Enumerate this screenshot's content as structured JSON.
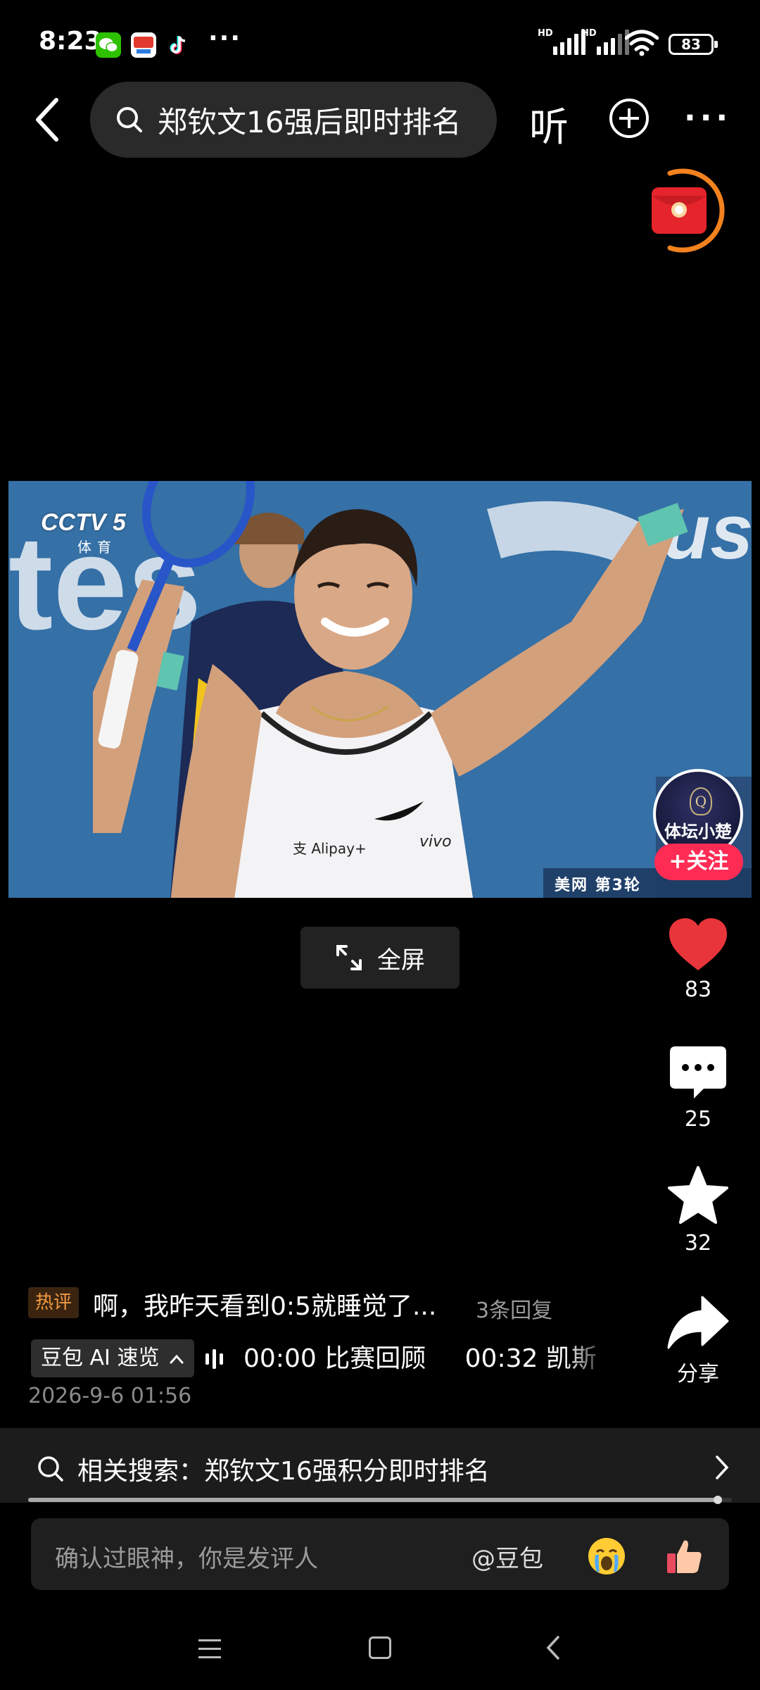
{
  "status_bar": {
    "time": "8:23",
    "more": "···",
    "battery": "83",
    "hd1": "HD",
    "hd2": "HD"
  },
  "header": {
    "search_query": "郑钦文16强后即时排名",
    "listen_label": "听"
  },
  "video": {
    "channel_logo": "CCTV 5",
    "channel_sub": "体育",
    "caption": "美网 第3轮",
    "shirt_sponsor_1": "支 Alipay+",
    "shirt_sponsor_2": "vivo"
  },
  "fullscreen_label": "全屏",
  "author": {
    "name": "体坛小楚",
    "badge": "Q",
    "follow_label": "+关注"
  },
  "rail": {
    "likes": "83",
    "comments": "25",
    "favorites": "32",
    "share_label": "分享"
  },
  "hot_comment": {
    "tag": "热评",
    "text": "啊，我昨天看到0:5就睡觉了...",
    "replies": "3条回复"
  },
  "ai_summary": {
    "chip_label": "豆包 AI 速览",
    "chapters": [
      "00:00 比赛回顾",
      "00:32 凯斯"
    ]
  },
  "post_date": "2026-9-6 01:56",
  "related_search": {
    "label": "相关搜索：郑钦文16强积分即时排名"
  },
  "playback": {
    "progress": 0.98
  },
  "comment_box": {
    "placeholder": "确认过眼神，你是发评人",
    "mention": "@豆包"
  },
  "colors": {
    "accent_red": "#fe2c55",
    "heart_red": "#e8353b",
    "hot_tag": "#f49a42"
  }
}
